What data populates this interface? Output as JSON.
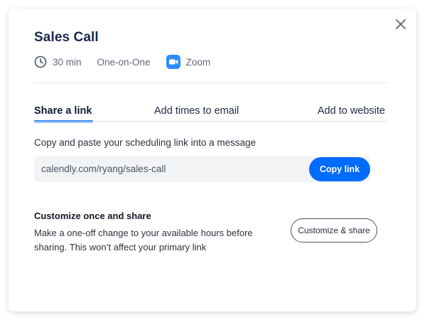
{
  "event": {
    "title": "Sales Call",
    "duration": "30 min",
    "type": "One-on-One",
    "location": "Zoom"
  },
  "tabs": [
    {
      "label": "Share a link",
      "active": true
    },
    {
      "label": "Add times to email",
      "active": false
    },
    {
      "label": "Add to website",
      "active": false
    }
  ],
  "share": {
    "instructions": "Copy and paste your scheduling link into a message",
    "link": "calendly.com/ryang/sales-call",
    "copy_label": "Copy link"
  },
  "customize": {
    "heading": "Customize once and share",
    "description": "Make a one-off change to your available hours before sharing. This won’t affect your primary link",
    "button_label": "Customize & share"
  },
  "icons": {
    "close": "close-icon",
    "clock": "clock-icon",
    "zoom": "zoom-icon"
  },
  "colors": {
    "accent": "#006bff",
    "zoom_blue": "#2d8cff",
    "title": "#1a2b4b"
  }
}
